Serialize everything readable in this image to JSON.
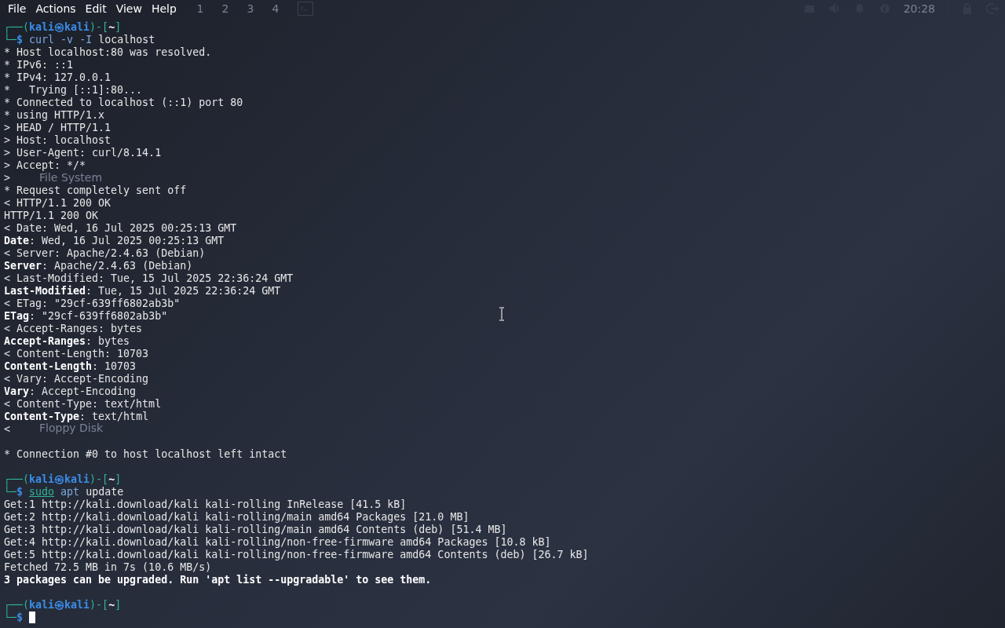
{
  "menu_bar": {
    "items": [
      "File",
      "Actions",
      "Edit",
      "View",
      "Help"
    ]
  },
  "panel": {
    "workspaces": [
      "1",
      "2",
      "3",
      "4"
    ],
    "clock": "20:28"
  },
  "desktop": {
    "icons": [
      "File System",
      "Floppy Disk"
    ]
  },
  "terminal": {
    "lines": [
      {
        "kind": "prompt",
        "open": "┌──(",
        "user": "kali",
        "symbol": "㉿",
        "host": "kali",
        "mid": ")-[",
        "dir": "~",
        "close": "]"
      },
      {
        "kind": "command",
        "corner": "└─",
        "sign": "$",
        "tokens": [
          {
            "kind": "cmd",
            "text": "curl"
          },
          {
            "kind": "option",
            "text": "-v"
          },
          {
            "kind": "option",
            "text": "-I"
          },
          {
            "kind": "arg",
            "text": "localhost"
          }
        ]
      },
      {
        "kind": "output",
        "text": "* Host localhost:80 was resolved."
      },
      {
        "kind": "output",
        "text": "* IPv6: ::1"
      },
      {
        "kind": "output",
        "text": "* IPv4: 127.0.0.1"
      },
      {
        "kind": "output",
        "text": "*   Trying [::1]:80..."
      },
      {
        "kind": "output",
        "text": "* Connected to localhost (::1) port 80"
      },
      {
        "kind": "output",
        "text": "* using HTTP/1.x"
      },
      {
        "kind": "output",
        "text": "> HEAD / HTTP/1.1"
      },
      {
        "kind": "output",
        "text": "> Host: localhost"
      },
      {
        "kind": "output",
        "text": "> User-Agent: curl/8.14.1"
      },
      {
        "kind": "output",
        "text": "> Accept: */*"
      },
      {
        "kind": "output",
        "text": ">"
      },
      {
        "kind": "output",
        "text": "* Request completely sent off"
      },
      {
        "kind": "output",
        "text": "< HTTP/1.1 200 OK"
      },
      {
        "kind": "output",
        "text": "HTTP/1.1 200 OK"
      },
      {
        "kind": "output",
        "text": "< Date: Wed, 16 Jul 2025 00:25:13 GMT"
      },
      {
        "kind": "header",
        "key": "Date",
        "rest": ": Wed, 16 Jul 2025 00:25:13 GMT"
      },
      {
        "kind": "output",
        "text": "< Server: Apache/2.4.63 (Debian)"
      },
      {
        "kind": "header",
        "key": "Server",
        "rest": ": Apache/2.4.63 (Debian)"
      },
      {
        "kind": "output",
        "text": "< Last-Modified: Tue, 15 Jul 2025 22:36:24 GMT"
      },
      {
        "kind": "header",
        "key": "Last-Modified",
        "rest": ": Tue, 15 Jul 2025 22:36:24 GMT"
      },
      {
        "kind": "output",
        "text": "< ETag: \"29cf-639ff6802ab3b\""
      },
      {
        "kind": "header",
        "key": "ETag",
        "rest": ": \"29cf-639ff6802ab3b\""
      },
      {
        "kind": "output",
        "text": "< Accept-Ranges: bytes"
      },
      {
        "kind": "header",
        "key": "Accept-Ranges",
        "rest": ": bytes"
      },
      {
        "kind": "output",
        "text": "< Content-Length: 10703"
      },
      {
        "kind": "header",
        "key": "Content-Length",
        "rest": ": 10703"
      },
      {
        "kind": "output",
        "text": "< Vary: Accept-Encoding"
      },
      {
        "kind": "header",
        "key": "Vary",
        "rest": ": Accept-Encoding"
      },
      {
        "kind": "output",
        "text": "< Content-Type: text/html"
      },
      {
        "kind": "header",
        "key": "Content-Type",
        "rest": ": text/html"
      },
      {
        "kind": "output",
        "text": "<"
      },
      {
        "kind": "blank"
      },
      {
        "kind": "output",
        "text": "* Connection #0 to host localhost left intact"
      },
      {
        "kind": "blank"
      },
      {
        "kind": "prompt",
        "open": "┌──(",
        "user": "kali",
        "symbol": "㉿",
        "host": "kali",
        "mid": ")-[",
        "dir": "~",
        "close": "]"
      },
      {
        "kind": "command",
        "corner": "└─",
        "sign": "$",
        "tokens": [
          {
            "kind": "sudo",
            "text": "sudo"
          },
          {
            "kind": "cmd",
            "text": "apt"
          },
          {
            "kind": "arg",
            "text": "update"
          }
        ]
      },
      {
        "kind": "output",
        "text": "Get:1 http://kali.download/kali kali-rolling InRelease [41.5 kB]"
      },
      {
        "kind": "output",
        "text": "Get:2 http://kali.download/kali kali-rolling/main amd64 Packages [21.0 MB]"
      },
      {
        "kind": "output",
        "text": "Get:3 http://kali.download/kali kali-rolling/main amd64 Contents (deb) [51.4 MB]"
      },
      {
        "kind": "output",
        "text": "Get:4 http://kali.download/kali kali-rolling/non-free-firmware amd64 Packages [10.8 kB]"
      },
      {
        "kind": "output",
        "text": "Get:5 http://kali.download/kali kali-rolling/non-free-firmware amd64 Contents (deb) [26.7 kB]"
      },
      {
        "kind": "output",
        "text": "Fetched 72.5 MB in 7s (10.6 MB/s)"
      },
      {
        "kind": "bold",
        "text": "3 packages can be upgraded. Run 'apt list --upgradable' to see them."
      },
      {
        "kind": "blank"
      },
      {
        "kind": "prompt",
        "open": "┌──(",
        "user": "kali",
        "symbol": "㉿",
        "host": "kali",
        "mid": ")-[",
        "dir": "~",
        "close": "]"
      },
      {
        "kind": "command",
        "corner": "└─",
        "sign": "$",
        "cursor": true
      }
    ]
  }
}
